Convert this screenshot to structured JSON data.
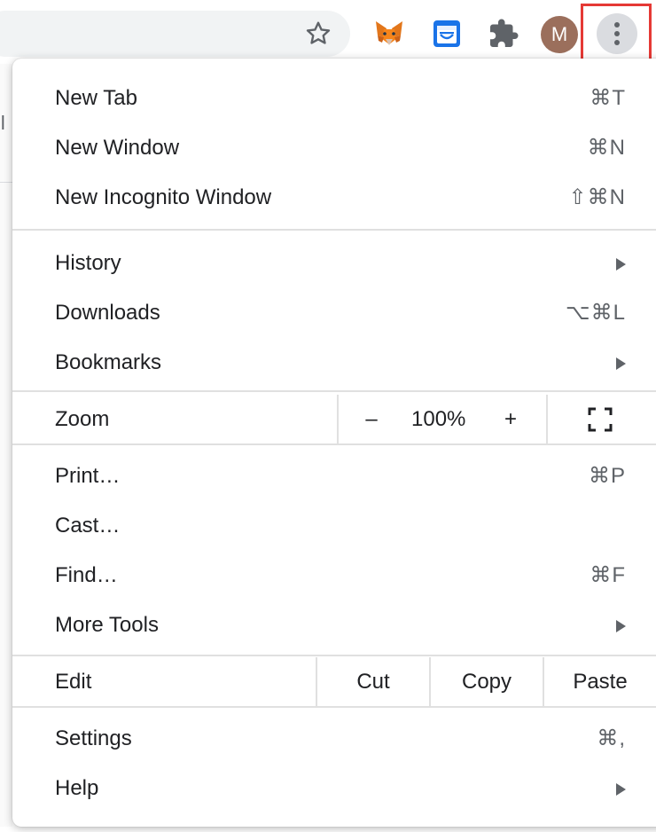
{
  "toolbar": {
    "avatar_letter": "M",
    "icons": [
      "star-icon",
      "metamask-fox-icon",
      "calendar-extension-icon",
      "extensions-puzzle-icon",
      "three-dot-menu-icon"
    ]
  },
  "page": {
    "partial_text": "il"
  },
  "colors": {
    "highlight": "#e53935",
    "avatar_bg": "#9b6f5c",
    "menu_button_bg": "#dadce0",
    "separator": "#e0e0e0",
    "text": "#202124",
    "shortcut_text": "#5f6368"
  },
  "menu": {
    "new_tab": {
      "label": "New Tab",
      "shortcut": "⌘T"
    },
    "new_window": {
      "label": "New Window",
      "shortcut": "⌘N"
    },
    "new_incognito": {
      "label": "New Incognito Window",
      "shortcut": "⇧⌘N"
    },
    "history": {
      "label": "History"
    },
    "downloads": {
      "label": "Downloads",
      "shortcut": "⌥⌘L"
    },
    "bookmarks": {
      "label": "Bookmarks"
    },
    "zoom": {
      "label": "Zoom",
      "minus": "–",
      "value": "100%",
      "plus": "+"
    },
    "print": {
      "label": "Print…",
      "shortcut": "⌘P"
    },
    "cast": {
      "label": "Cast…"
    },
    "find": {
      "label": "Find…",
      "shortcut": "⌘F"
    },
    "more_tools": {
      "label": "More Tools"
    },
    "edit": {
      "label": "Edit",
      "cut": "Cut",
      "copy": "Copy",
      "paste": "Paste"
    },
    "settings": {
      "label": "Settings",
      "shortcut": "⌘,"
    },
    "help": {
      "label": "Help"
    }
  }
}
